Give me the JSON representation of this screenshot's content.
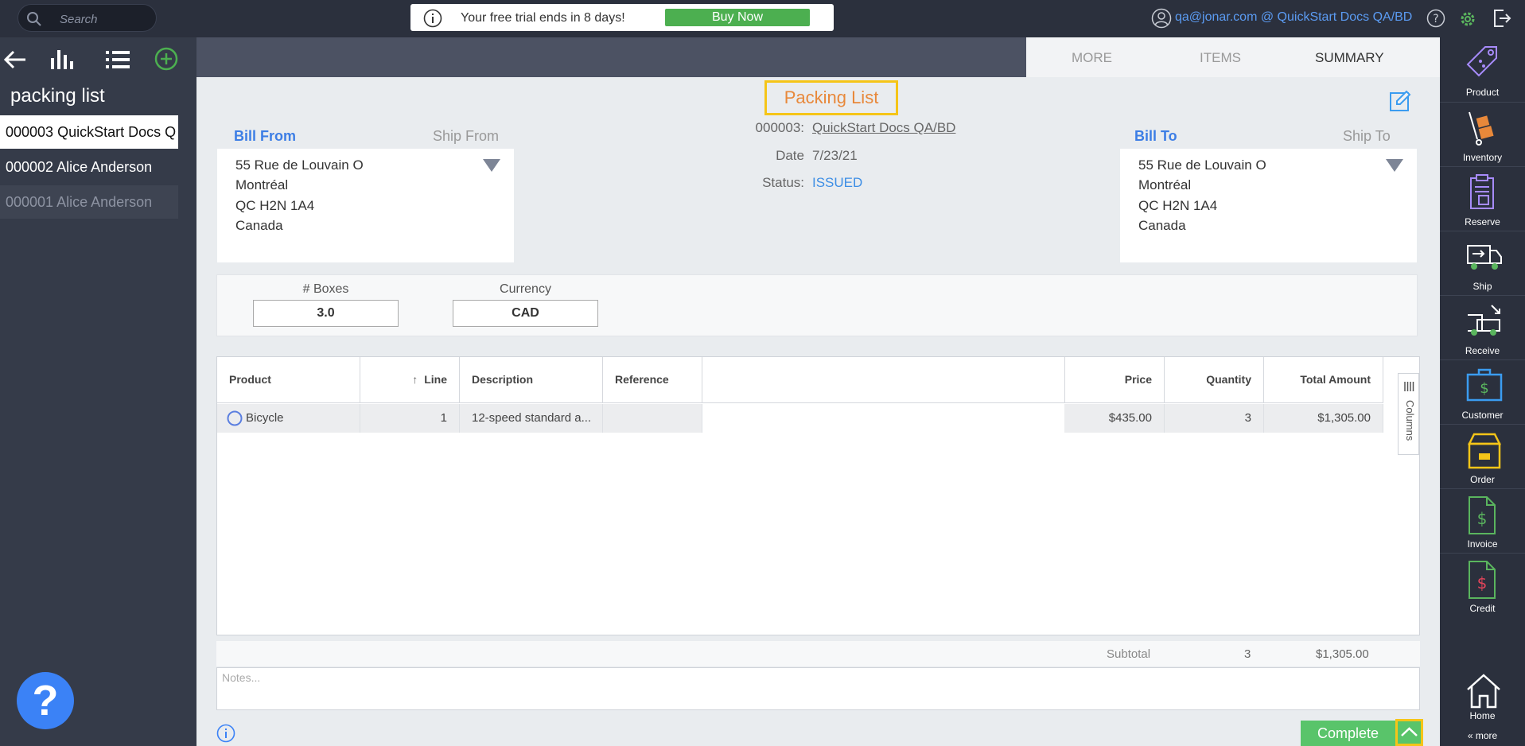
{
  "topbar": {
    "search_placeholder": "Search",
    "trial_text": "Your free trial ends in 8 days!",
    "buy_label": "Buy Now",
    "user_text": "qa@jonar.com @ QuickStart Docs QA/BD"
  },
  "left": {
    "title": "packing list",
    "items": [
      {
        "label": "000003 QuickStart Docs Q"
      },
      {
        "label": "000002 Alice Anderson"
      },
      {
        "label": "000001 Alice Anderson"
      }
    ],
    "help_label": "?"
  },
  "tabs": [
    {
      "label": "MORE"
    },
    {
      "label": "ITEMS"
    },
    {
      "label": "SUMMARY"
    }
  ],
  "document": {
    "title": "Packing List",
    "number_label": "000003:",
    "number_value": "QuickStart Docs QA/BD",
    "date_label": "Date",
    "date_value": "7/23/21",
    "status_label": "Status:",
    "status_value": "ISSUED"
  },
  "bill_from": {
    "title": "Bill From",
    "alt": "Ship From",
    "lines": [
      "55 Rue de Louvain O",
      "Montréal",
      "QC H2N 1A4",
      "Canada"
    ]
  },
  "bill_to": {
    "title": "Bill To",
    "alt": "Ship To",
    "lines": [
      "55 Rue de Louvain O",
      "Montréal",
      "QC H2N 1A4",
      "Canada"
    ]
  },
  "fields": {
    "boxes_label": "# Boxes",
    "boxes_value": "3.0",
    "currency_label": "Currency",
    "currency_value": "CAD"
  },
  "grid": {
    "headers": {
      "product": "Product",
      "line": "Line",
      "description": "Description",
      "reference": "Reference",
      "price": "Price",
      "quantity": "Quantity",
      "total": "Total Amount"
    },
    "sort_arrow": "↑",
    "rows": [
      {
        "product": "Bicycle",
        "line": "1",
        "description": "12-speed standard a...",
        "reference": "",
        "price": "$435.00",
        "quantity": "3",
        "total": "$1,305.00"
      }
    ],
    "columns_label": "Columns"
  },
  "subtotal": {
    "label": "Subtotal",
    "quantity": "3",
    "total": "$1,305.00"
  },
  "notes_placeholder": "Notes...",
  "complete_label": "Complete",
  "right_nav": [
    {
      "label": "Product",
      "icon": "tag-icon"
    },
    {
      "label": "Inventory",
      "icon": "hand-truck-icon"
    },
    {
      "label": "Reserve",
      "icon": "clipboard-icon"
    },
    {
      "label": "Ship",
      "icon": "truck-out-icon"
    },
    {
      "label": "Receive",
      "icon": "truck-in-icon"
    },
    {
      "label": "Customer",
      "icon": "bag-dollar-icon"
    },
    {
      "label": "Order",
      "icon": "box-icon"
    },
    {
      "label": "Invoice",
      "icon": "invoice-icon"
    },
    {
      "label": "Credit",
      "icon": "credit-icon"
    },
    {
      "label": "Home",
      "icon": "home-icon"
    }
  ],
  "more_label": "« more",
  "colors": {
    "accent": "#3d7ee5",
    "success": "#59c46a",
    "highlight": "#f5c518",
    "title_orange": "#e8883a"
  }
}
